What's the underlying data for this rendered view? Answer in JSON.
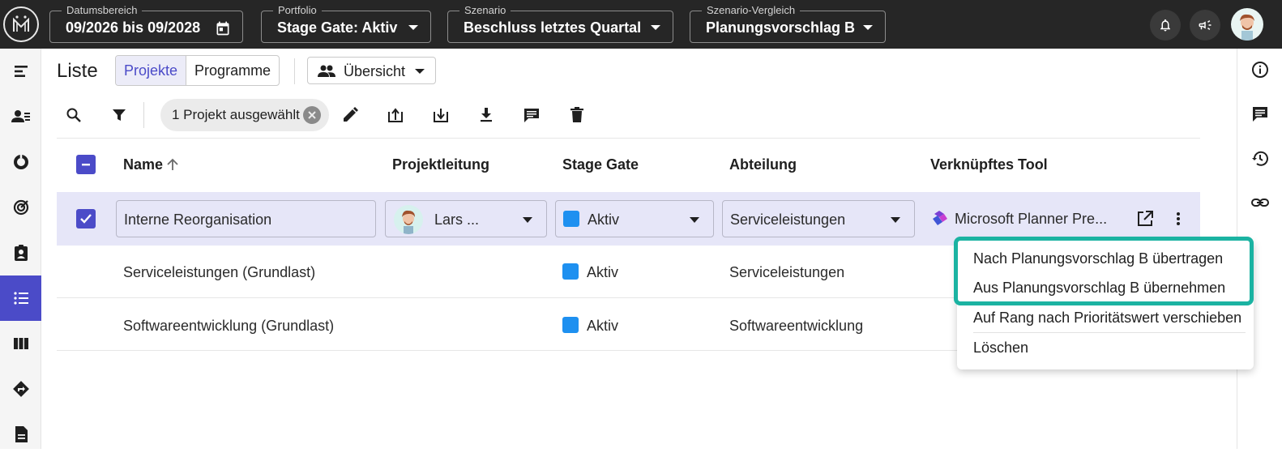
{
  "topbar": {
    "logo": "app-logo",
    "filters": [
      {
        "label": "Datumsbereich",
        "value": "09/2026 bis 09/2028",
        "icon": "calendar-icon"
      },
      {
        "label": "Portfolio",
        "value": "Stage Gate: Aktiv",
        "icon": "chevron-down-icon"
      },
      {
        "label": "Szenario",
        "value": "Beschluss letztes Quartal",
        "icon": "chevron-down-icon"
      },
      {
        "label": "Szenario-Vergleich",
        "value": "Planungsvorschlag B",
        "icon": "chevron-down-icon"
      }
    ],
    "icons": [
      "bell-icon",
      "megaphone-icon",
      "user-avatar"
    ]
  },
  "leftnav": {
    "items": [
      "hierarchy-icon",
      "team-icon",
      "donut-chart-icon",
      "target-icon",
      "clipboard-icon",
      "list-icon",
      "columns-icon",
      "roadmap-icon",
      "document-icon"
    ],
    "active_index": 5
  },
  "rightnav": {
    "items": [
      "info-icon",
      "comments-icon",
      "history-icon",
      "link-icon"
    ]
  },
  "header": {
    "title": "Liste",
    "tabs": [
      "Projekte",
      "Programme"
    ],
    "active_tab": "Projekte",
    "view_button": "Übersicht"
  },
  "toolbar": {
    "icons": [
      "search-icon",
      "filter-icon",
      "edit-icon",
      "export-icon",
      "import-icon",
      "download-icon",
      "comment-icon",
      "delete-icon"
    ],
    "selection_chip": "1 Projekt ausgewählt"
  },
  "table": {
    "columns": [
      "Name",
      "Projektleitung",
      "Stage Gate",
      "Abteilung",
      "Verknüpftes Tool"
    ],
    "sort": {
      "column": "Name",
      "direction": "ascending"
    },
    "rows": [
      {
        "name": "Interne Reorganisation",
        "lead": "Lars ...",
        "stage_gate": "Aktiv",
        "department": "Serviceleistungen",
        "tool": "Microsoft Planner Pre...",
        "selected": true
      },
      {
        "name": "Serviceleistungen (Grundlast)",
        "lead": "",
        "stage_gate": "Aktiv",
        "department": "Serviceleistungen",
        "tool": "",
        "selected": false
      },
      {
        "name": "Softwareentwicklung (Grundlast)",
        "lead": "",
        "stage_gate": "Aktiv",
        "department": "Softwareentwicklung",
        "tool": "",
        "selected": false
      }
    ],
    "stage_gate_color": "#1e90f0"
  },
  "context_menu": {
    "items": [
      "Nach Planungsvorschlag B übertragen",
      "Aus Planungsvorschlag B übernehmen",
      "Auf Rang nach Prioritätswert verschieben",
      "Löschen"
    ]
  },
  "colors": {
    "accent": "#4b4bc8",
    "highlight": "#1bb3a2",
    "topbar": "#262626"
  }
}
